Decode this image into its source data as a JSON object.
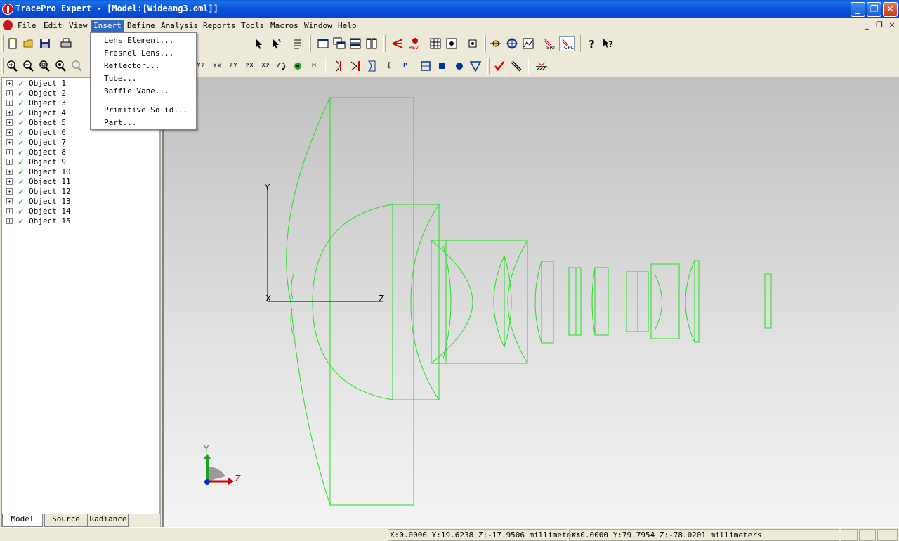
{
  "window": {
    "title": "TracePro Expert - [Model:[Wideang3.oml]]",
    "minimize_label": "_",
    "restore_label": "❐",
    "close_label": "✕"
  },
  "menubar": {
    "items": [
      "File",
      "Edit",
      "View",
      "Insert",
      "Define",
      "Analysis",
      "Reports",
      "Tools",
      "Macros",
      "Window",
      "Help"
    ],
    "active": "Insert",
    "mdi": {
      "minimize": "_",
      "restore": "❐",
      "close": "×"
    }
  },
  "insert_menu": {
    "items": [
      "Lens Element...",
      "Fresnel Lens...",
      "Reflector...",
      "Tube...",
      "Baffle Vane...",
      "Primitive Solid...",
      "Part..."
    ]
  },
  "toolbar1": {
    "icons": [
      "new-icon",
      "open-icon",
      "save-icon",
      "print-icon",
      "select-icon",
      "select-surface-icon",
      "properties-icon",
      "window-icon",
      "cascade-icon",
      "tile-h-icon",
      "tile-v-icon",
      "trace-rays-icon",
      "raytrace-icon",
      "grid-icon",
      "camera-icon",
      "target-icon",
      "source-point-icon",
      "crosshair-icon",
      "irradiance-icon",
      "srt-icon",
      "opl-icon",
      "help-icon",
      "context-help-icon"
    ],
    "srt_label": "SRT",
    "opl_label": "OPL",
    "rev_label": "REV"
  },
  "toolbar2": {
    "icons": [
      "zoom-in-icon",
      "zoom-out-icon",
      "zoom-window-icon",
      "zoom-all-icon",
      "zoom-prev-icon",
      "rotate-z-icon",
      "rotate-x-icon",
      "view-zy-icon",
      "view-zx-icon",
      "view-xz-icon",
      "rotate-icon",
      "fan-icon",
      "h-icon",
      "lens-icon",
      "mirror-icon",
      "prism-icon",
      "bracket-icon",
      "p-icon",
      "box-icon",
      "solid-icon",
      "sphere-icon",
      "cone-icon",
      "check-icon",
      "ruler-icon",
      "mirror-plane-icon"
    ],
    "labels": {
      "rot_z": "Yz",
      "rot_x": "Yx",
      "zy": "zY",
      "zx": "zX",
      "xz": "Xz",
      "h": "H",
      "p": "P",
      "bracket": "["
    }
  },
  "tree": {
    "items": [
      "Object 1",
      "Object 2",
      "Object 3",
      "Object 4",
      "Object 5",
      "Object 6",
      "Object 7",
      "Object 8",
      "Object 9",
      "Object 10",
      "Object 11",
      "Object 12",
      "Object 13",
      "Object 14",
      "Object 15"
    ],
    "expander": "+",
    "check": "✓"
  },
  "tabs": [
    "Model",
    "Source",
    "Radiance"
  ],
  "viewport": {
    "axis_labels": {
      "y": "Y",
      "x": "X",
      "z": "Z"
    },
    "triad_labels": {
      "y": "Y",
      "z": "Z"
    },
    "wire_color": "#22dd22"
  },
  "statusbar": {
    "cell1": "X:0.0000 Y:19.6238 Z:-17.9506 millimeters",
    "cell2": "X:0.0000 Y:79.7954 Z:-78.0201 millimeters"
  }
}
